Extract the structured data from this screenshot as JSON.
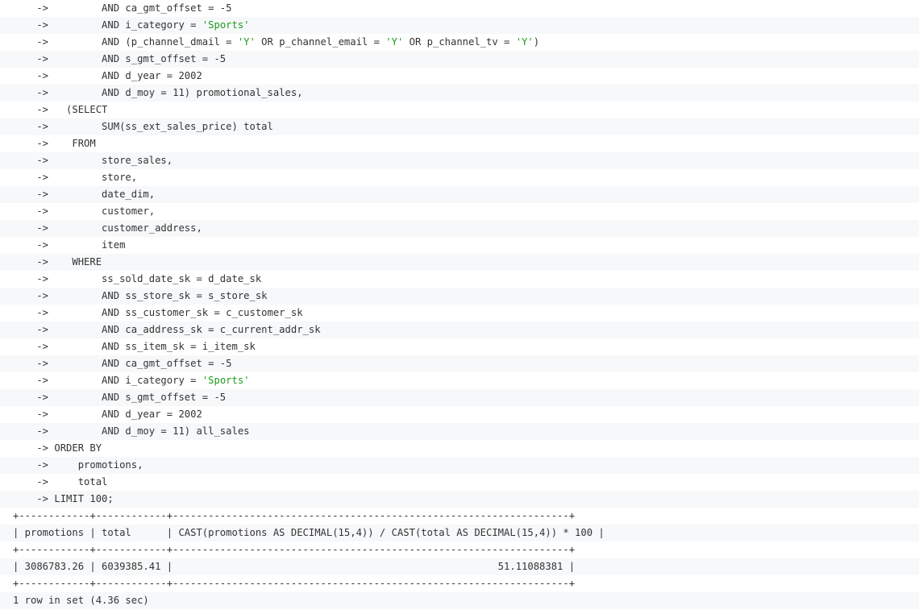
{
  "console": {
    "lines": [
      "    ->         AND ca_gmt_offset = -5",
      "    ->         AND i_category = 'Sports'",
      "    ->         AND (p_channel_dmail = 'Y' OR p_channel_email = 'Y' OR p_channel_tv = 'Y')",
      "    ->         AND s_gmt_offset = -5",
      "    ->         AND d_year = 2002",
      "    ->         AND d_moy = 11) promotional_sales,",
      "    ->   (SELECT",
      "    ->         SUM(ss_ext_sales_price) total",
      "    ->    FROM",
      "    ->         store_sales,",
      "    ->         store,",
      "    ->         date_dim,",
      "    ->         customer,",
      "    ->         customer_address,",
      "    ->         item",
      "    ->    WHERE",
      "    ->         ss_sold_date_sk = d_date_sk",
      "    ->         AND ss_store_sk = s_store_sk",
      "    ->         AND ss_customer_sk = c_customer_sk",
      "    ->         AND ca_address_sk = c_current_addr_sk",
      "    ->         AND ss_item_sk = i_item_sk",
      "    ->         AND ca_gmt_offset = -5",
      "    ->         AND i_category = 'Sports'",
      "    ->         AND s_gmt_offset = -5",
      "    ->         AND d_year = 2002",
      "    ->         AND d_moy = 11) all_sales",
      "    -> ORDER BY",
      "    ->     promotions,",
      "    ->     total",
      "    -> LIMIT 100;",
      "+------------+------------+-------------------------------------------------------------------+",
      "| promotions | total      | CAST(promotions AS DECIMAL(15,4)) / CAST(total AS DECIMAL(15,4)) * 100 |",
      "+------------+------------+-------------------------------------------------------------------+",
      "| 3086783.26 | 6039385.41 |                                                       51.11088381 |",
      "+------------+------------+-------------------------------------------------------------------+",
      "1 row in set (4.36 sec)"
    ]
  },
  "colors": {
    "text": "#333333",
    "string_literal": "#1f9a1f",
    "row_shade": "#f6f8fa",
    "row_plain": "#ffffff"
  }
}
